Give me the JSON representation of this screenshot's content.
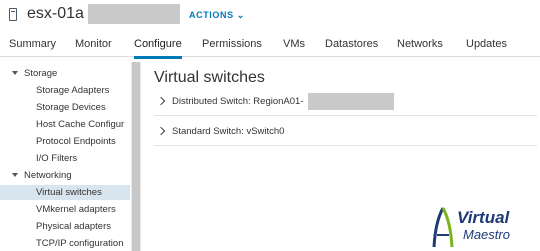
{
  "header": {
    "host_name": "esx-01a",
    "actions_label": "ACTIONS ⌄"
  },
  "tabs": [
    {
      "label": "Summary"
    },
    {
      "label": "Monitor"
    },
    {
      "label": "Configure",
      "active": true
    },
    {
      "label": "Permissions"
    },
    {
      "label": "VMs"
    },
    {
      "label": "Datastores"
    },
    {
      "label": "Networks"
    },
    {
      "label": "Updates"
    }
  ],
  "sidebar": {
    "storage_group": "Storage",
    "storage_items": [
      "Storage Adapters",
      "Storage Devices",
      "Host Cache Configur",
      "Protocol Endpoints",
      "I/O Filters"
    ],
    "networking_group": "Networking",
    "networking_items": [
      "Virtual switches",
      "VMkernel adapters",
      "Physical adapters",
      "TCP/IP configuration"
    ],
    "selected": "Virtual switches"
  },
  "main": {
    "title": "Virtual switches",
    "switches": [
      {
        "label": "Distributed Switch: RegionA01-"
      },
      {
        "label": "Standard Switch: vSwitch0"
      }
    ]
  },
  "watermark": {
    "line1": "Virtual",
    "line2": "Maestro"
  },
  "colors": {
    "accent": "#0079b8",
    "selected_bg": "#d8e4ee",
    "logo_blue": "#1f3a78",
    "logo_green": "#7ab51d"
  }
}
